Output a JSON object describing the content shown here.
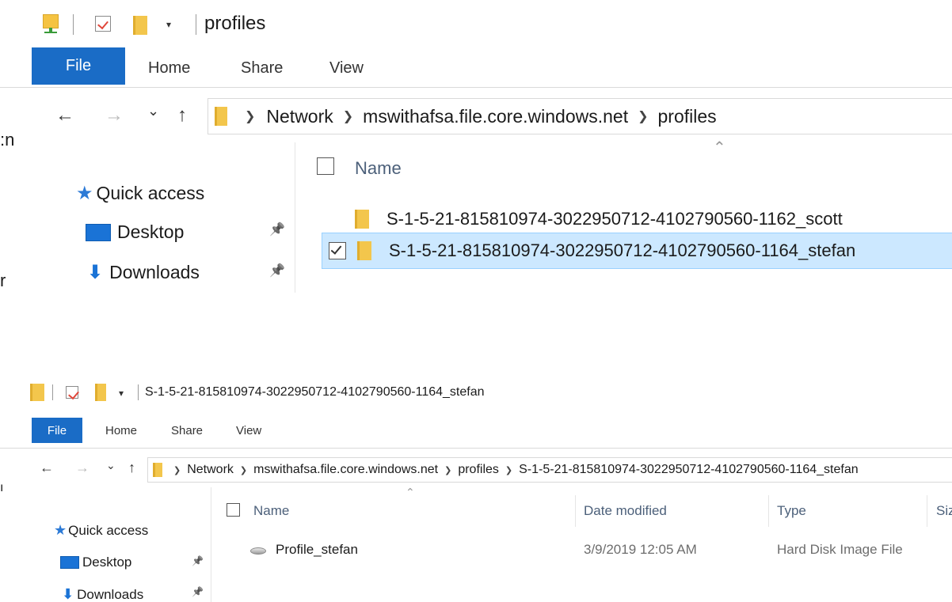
{
  "windows": [
    {
      "title": "profiles",
      "ribbon_tabs": [
        "File",
        "Home",
        "Share",
        "View"
      ],
      "nav": {
        "back": "←",
        "forward": "→",
        "recent": "⌄",
        "up": "↑"
      },
      "breadcrumbs": [
        "Network",
        "mswithafsa.file.core.windows.net",
        "profiles"
      ],
      "left_edge_text": [
        ":n",
        "r"
      ],
      "quick_access": [
        "Quick access",
        "Desktop",
        "Downloads"
      ],
      "pin_glyph": "📌",
      "sort_caret": "⌃",
      "columns": [
        "Name"
      ],
      "items": [
        {
          "name": "S-1-5-21-815810974-3022950712-4102790560-1162_scott",
          "selected": false
        },
        {
          "name": "S-1-5-21-815810974-3022950712-4102790560-1164_stefan",
          "selected": true
        }
      ]
    },
    {
      "title": "S-1-5-21-815810974-3022950712-4102790560-1164_stefan",
      "ribbon_tabs": [
        "File",
        "Home",
        "Share",
        "View"
      ],
      "nav": {
        "back": "←",
        "forward": "→",
        "recent": "⌄",
        "up": "↑"
      },
      "breadcrumbs": [
        "Network",
        "mswithafsa.file.core.windows.net",
        "profiles",
        "S-1-5-21-815810974-3022950712-4102790560-1164_stefan"
      ],
      "left_edge_text": [
        "ı"
      ],
      "quick_access": [
        "Quick access",
        "Desktop",
        "Downloads"
      ],
      "pin_glyph": "📌",
      "sort_caret": "⌃",
      "columns": [
        "Name",
        "Date modified",
        "Type",
        "Siz"
      ],
      "items": [
        {
          "name": "Profile_stefan",
          "date_modified": "3/9/2019 12:05 AM",
          "type": "Hard Disk Image File"
        }
      ]
    }
  ],
  "icons": [
    "drive-icon",
    "properties-check-icon",
    "folder-icon",
    "dropdown-arrow-icon",
    "pin-icon",
    "star-icon",
    "desktop-icon",
    "download-icon",
    "disk-image-icon"
  ],
  "colors": {
    "file_tab": "#1a6cc6",
    "selection": "#cce8ff",
    "selection_border": "#99d1ff",
    "header_text": "#4c607a"
  }
}
